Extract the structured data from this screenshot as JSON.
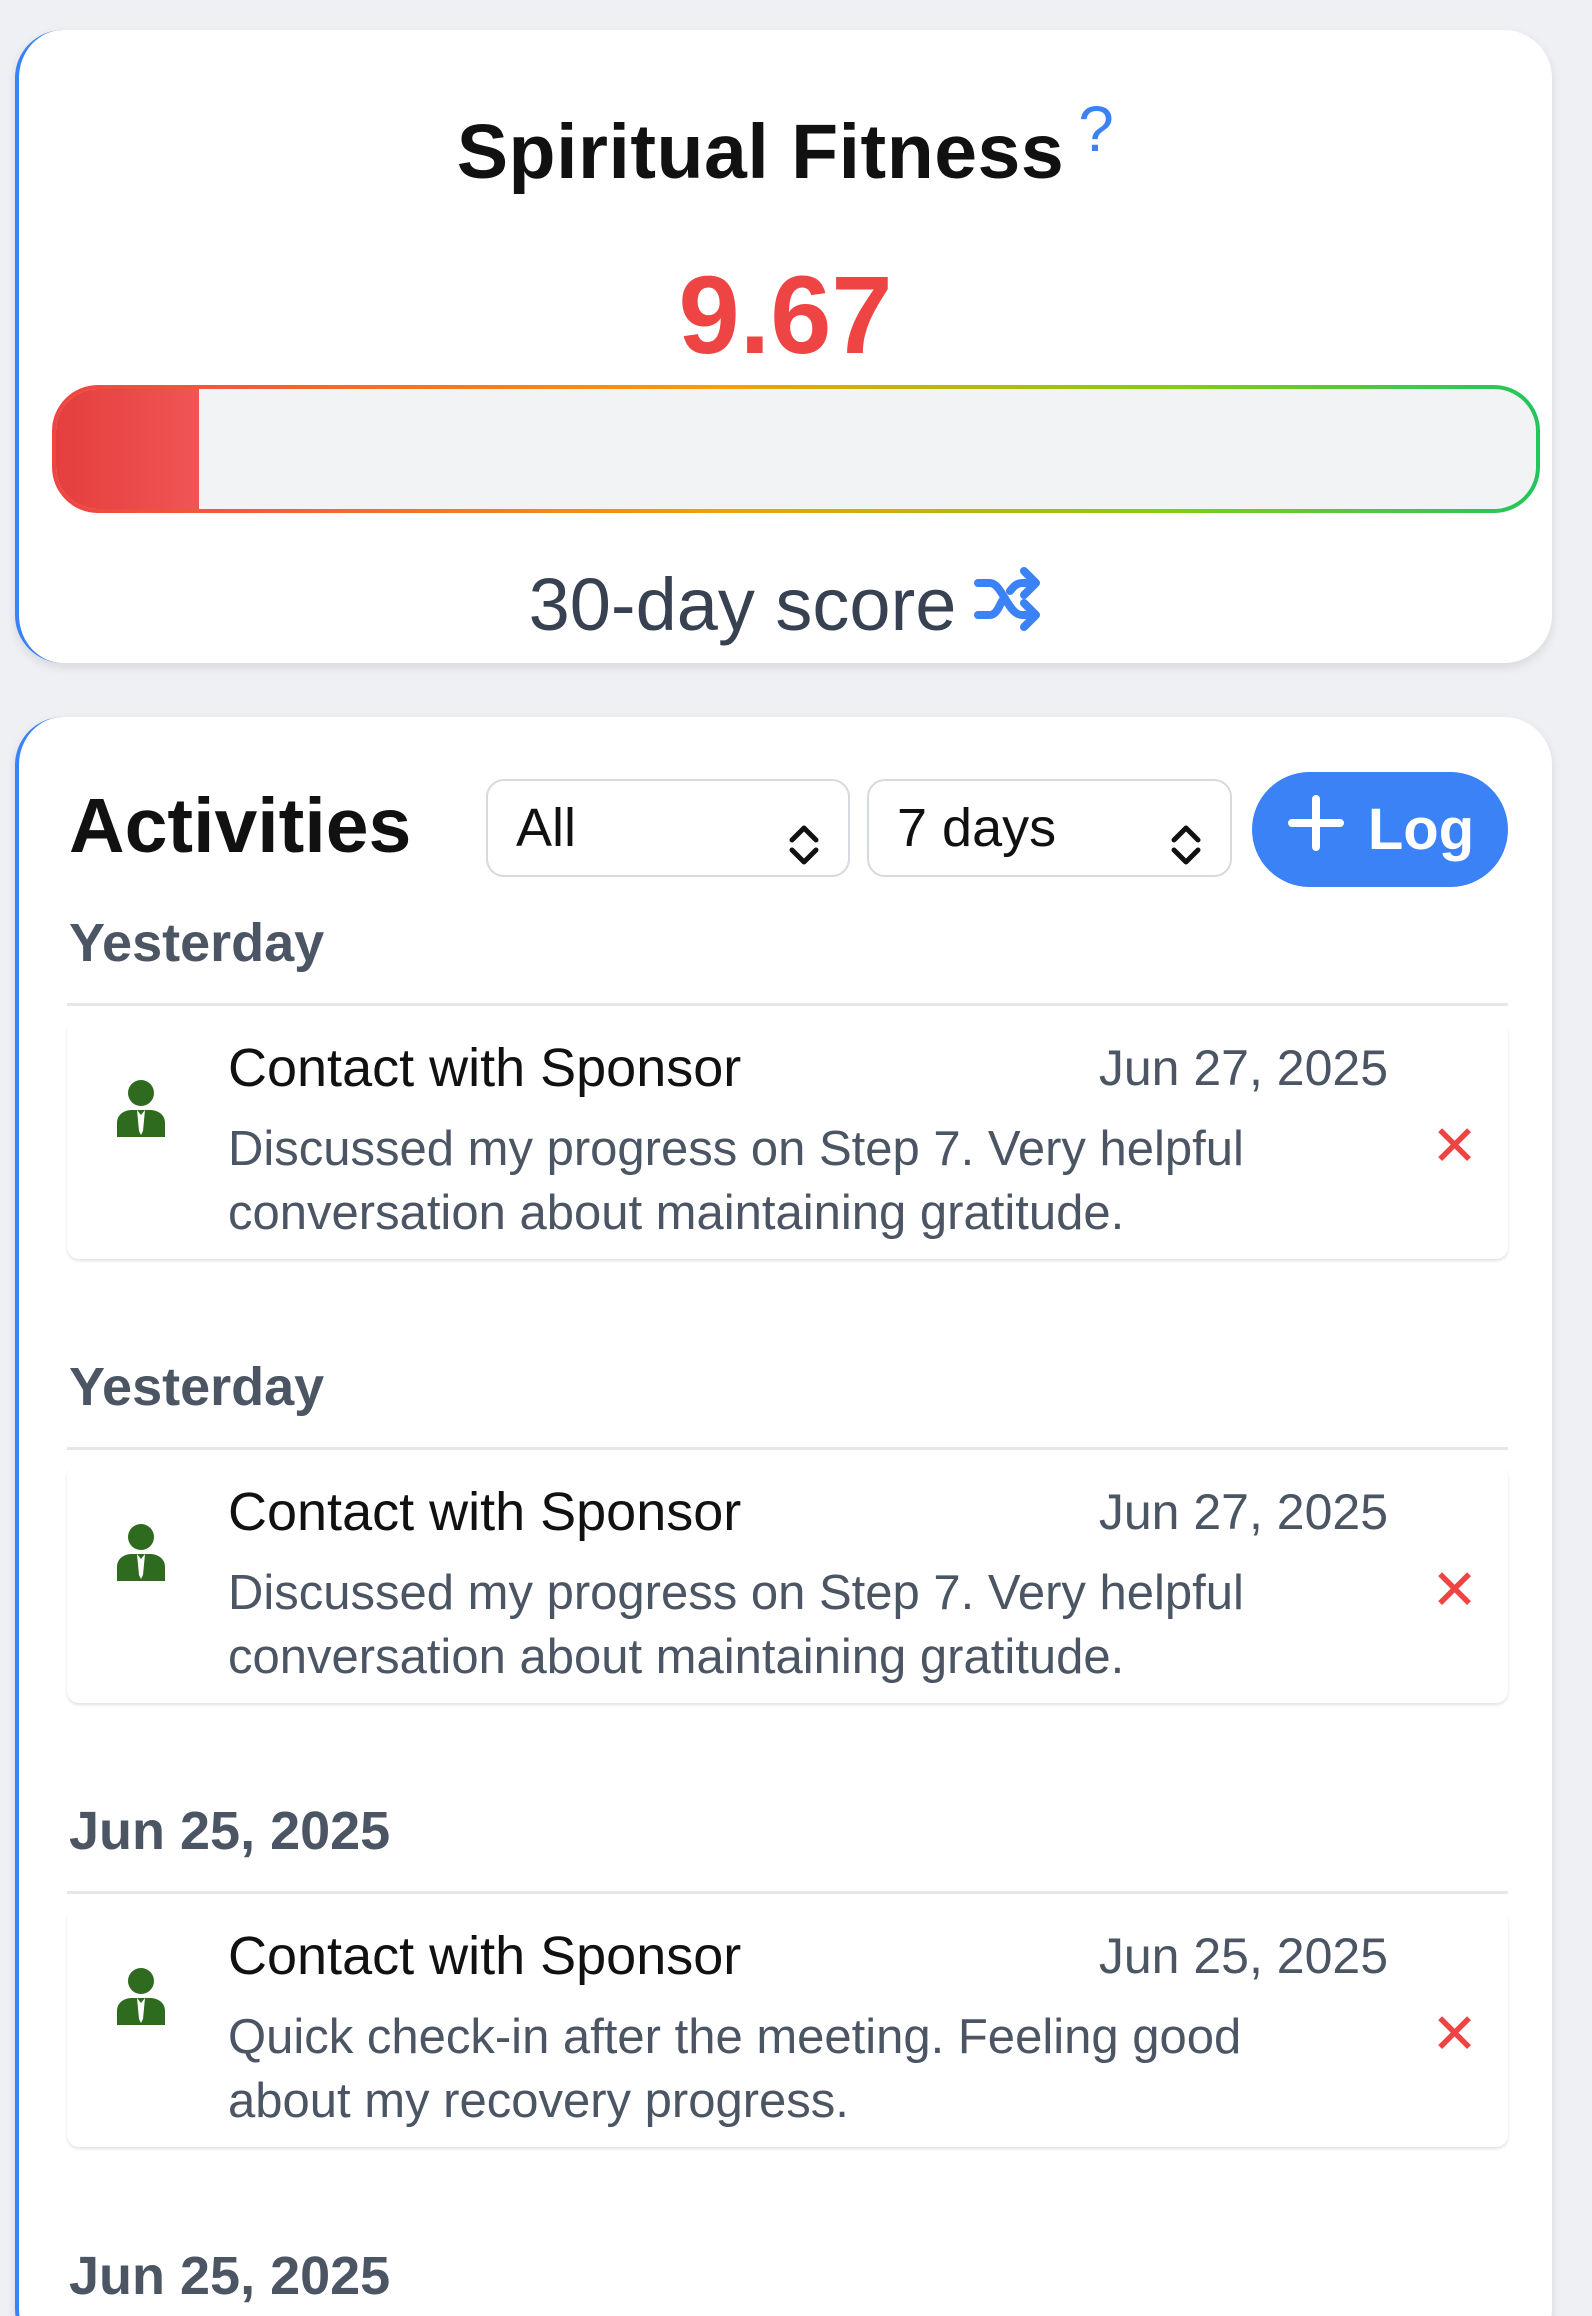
{
  "fitness": {
    "title": "Spiritual Fitness",
    "help_glyph": "?",
    "score": "9.67",
    "score_fraction": 0.0967,
    "score_label": "30-day score",
    "accent_color": "#ef4444",
    "help_color": "#3b82f6"
  },
  "activities": {
    "title": "Activities",
    "type_filter": {
      "selected": "All"
    },
    "range_filter": {
      "selected": "7 days"
    },
    "log_button": {
      "label": "Log",
      "icon": "plus-icon"
    },
    "groups": [
      {
        "date": "Yesterday",
        "entry": {
          "icon": "person-icon",
          "title": "Contact with Sponsor",
          "date": "Jun 27, 2025",
          "note": "Discussed my progress on Step 7. Very helpful conversation about maintaining gratitude."
        }
      },
      {
        "date": "Yesterday",
        "entry": {
          "icon": "person-icon",
          "title": "Contact with Sponsor",
          "date": "Jun 27, 2025",
          "note": "Discussed my progress on Step 7. Very helpful conversation about maintaining gratitude."
        }
      },
      {
        "date": "Jun 25, 2025",
        "entry": {
          "icon": "person-icon",
          "title": "Contact with Sponsor",
          "date": "Jun 25, 2025",
          "note": "Quick check-in after the meeting. Feeling good about my recovery progress."
        }
      },
      {
        "date": "Jun 25, 2025"
      }
    ],
    "delete_glyph": "✕"
  }
}
